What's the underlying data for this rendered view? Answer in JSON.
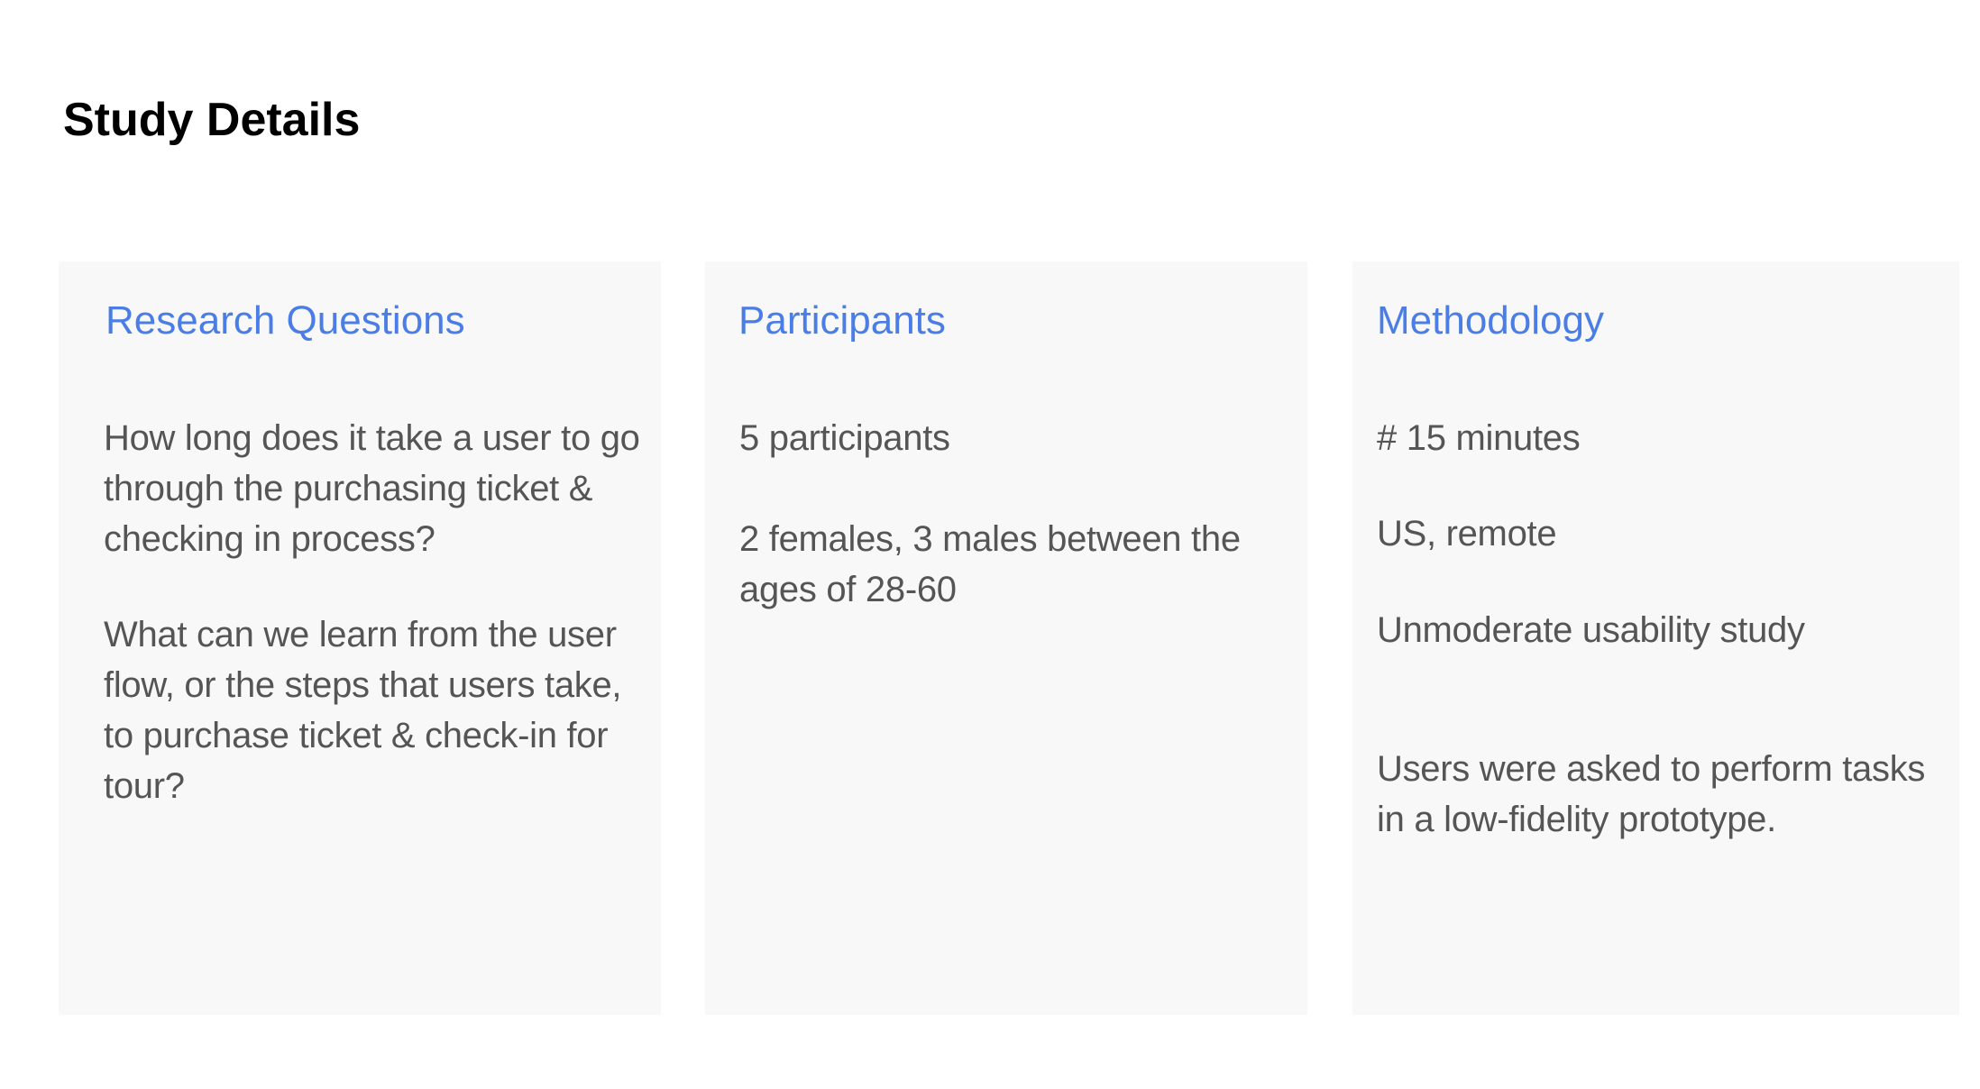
{
  "page": {
    "title": "Study Details"
  },
  "cards": [
    {
      "title": "Research Questions",
      "paragraphs": [
        "How long does it take a user to go through the purchasing ticket & checking in process?",
        "What can we learn from the user flow, or the steps that users take, to purchase ticket & check-in for tour?"
      ]
    },
    {
      "title": "Participants",
      "paragraphs": [
        "5 participants",
        "2 females, 3 males between the ages of 28-60"
      ]
    },
    {
      "title": "Methodology",
      "paragraphs": [
        "# 15 minutes",
        "US, remote",
        "Unmoderate usability study",
        "Users were asked to perform tasks in a low-fidelity prototype."
      ]
    }
  ],
  "colors": {
    "card_background": "#f8f8f8",
    "card_title": "#4a7ee6",
    "body_text": "#555555",
    "page_title": "#000000"
  }
}
